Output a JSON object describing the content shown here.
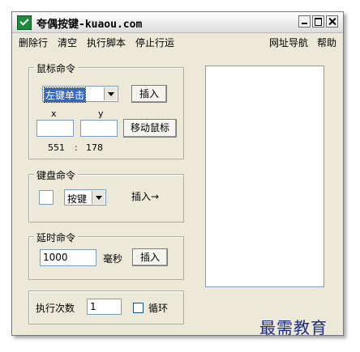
{
  "window": {
    "title": "夸偶按键-kuaou.com"
  },
  "menu": {
    "left": [
      "删除行",
      "清空",
      "执行脚本",
      "停止行运"
    ],
    "right": [
      "网址导航",
      "帮助"
    ]
  },
  "mouse_group": {
    "label": "鼠标命令",
    "action_select": "左键单击",
    "insert_button": "插入",
    "x_label": "x",
    "y_label": "y",
    "x_value": "",
    "y_value": "",
    "move_button": "移动鼠标",
    "coord_x": "551",
    "coord_sep": ":",
    "coord_y": "178"
  },
  "keyboard_group": {
    "label": "键盘命令",
    "key_select": "按键",
    "insert_button": "插入→"
  },
  "delay_group": {
    "label": "延时命令",
    "value": "1000",
    "unit": "毫秒",
    "insert_button": "插入"
  },
  "exec_group": {
    "label": "执行次数",
    "value": "1",
    "loop_label": "循环"
  },
  "watermark": "最需教育"
}
